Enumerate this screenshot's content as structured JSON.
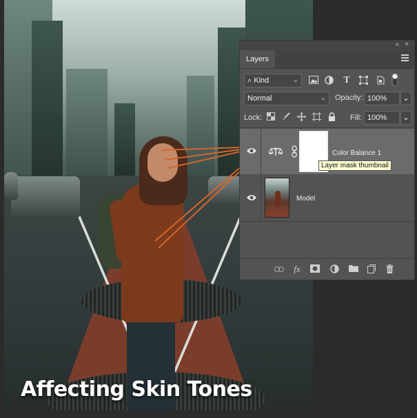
{
  "caption": "Affecting Skin Tones",
  "panel": {
    "collapse_glyph": "«",
    "close_glyph": "×",
    "tab": "Layers",
    "filter": {
      "search_glyph": "⌕",
      "kind_label": "Kind",
      "type_glyph": "T"
    },
    "blend_mode": "Normal",
    "opacity_label": "Opacity:",
    "opacity_value": "100%",
    "lock_label": "Lock:",
    "fill_label": "Fill:",
    "fill_value": "100%",
    "layers": [
      {
        "name": "Color Balance 1",
        "selected": true
      },
      {
        "name": "Model",
        "selected": false
      }
    ],
    "tooltip": "Layer mask thumbnail",
    "footer": {
      "fx_label": "fx"
    }
  },
  "colors": {
    "panel_bg": "#535353",
    "selected_row": "#6b6b6b",
    "tooltip_bg": "#fffbd0",
    "connector": "#d8652a"
  },
  "icons": [
    "search-icon",
    "image-filter-icon",
    "adjustment-filter-icon",
    "type-filter-icon",
    "shape-filter-icon",
    "smart-object-filter-icon",
    "filter-toggle-icon",
    "lock-transparent-icon",
    "lock-paint-icon",
    "lock-position-icon",
    "lock-artboard-icon",
    "lock-all-icon",
    "eye-icon",
    "color-balance-icon",
    "chain-link-icon",
    "link-layers-icon",
    "add-style-icon",
    "add-mask-icon",
    "new-adjustment-icon",
    "new-group-icon",
    "new-layer-icon",
    "trash-icon",
    "menu-icon"
  ]
}
